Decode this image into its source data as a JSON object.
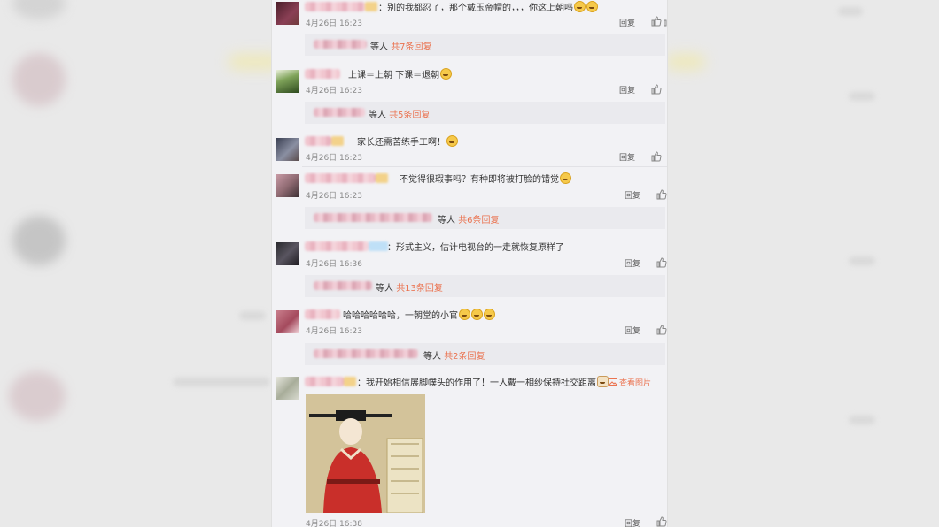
{
  "comments": [
    {
      "text": "：别的我都忍了，那个戴玉帝帽的，，，你这上朝吗",
      "time": "4月26日 16:23",
      "reply": "回复",
      "sub": {
        "prefix": "等人",
        "count": "共7条回复"
      }
    },
    {
      "text": "上课＝上朝 下课＝退朝",
      "time": "4月26日 16:23",
      "reply": "回复",
      "sub": {
        "prefix": "等人",
        "count": "共5条回复"
      }
    },
    {
      "text": "家长还需苦练手工啊！",
      "time": "4月26日 16:23",
      "reply": "回复"
    },
    {
      "text": "不觉得很瑕事吗？有种即将被打脸的错觉",
      "time": "4月26日 16:23",
      "reply": "回复",
      "sub": {
        "prefix": "等人",
        "count": "共6条回复"
      }
    },
    {
      "text": "：形式主义，估计电视台的一走就恢复原样了",
      "time": "4月26日 16:36",
      "reply": "回复",
      "sub": {
        "prefix": "等人",
        "count": "共13条回复"
      }
    },
    {
      "text": "哈哈哈哈哈哈，一朝堂的小官",
      "time": "4月26日 16:23",
      "reply": "回复",
      "sub": {
        "prefix": "等人",
        "count": "共2条回复"
      }
    },
    {
      "text": "：我开始相信展脚幞头的作用了！一人戴一相纱保持社交距离",
      "time": "4月26日 16:38",
      "reply": "回复",
      "view_pic": "查看图片"
    }
  ],
  "icons": {
    "like": "thumbs-up-icon",
    "view": "image-icon",
    "emoji": "emoji-icon"
  },
  "colors": {
    "accent": "#eb7350",
    "panel": "#f2f2f5"
  }
}
